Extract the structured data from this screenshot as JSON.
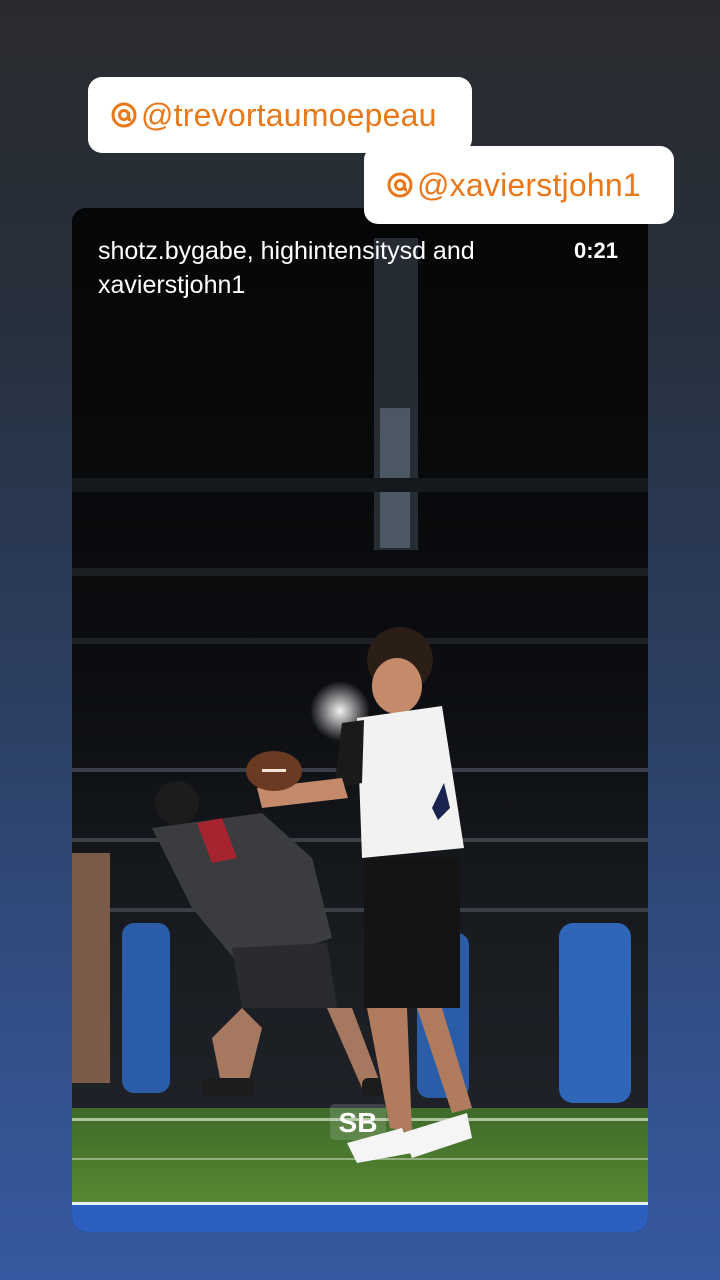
{
  "mentions": [
    {
      "handle": "@trevortaumoepeau",
      "icon": "threads-icon"
    },
    {
      "handle": "@xavierstjohn1",
      "icon": "threads-icon"
    }
  ],
  "post": {
    "authors": "shotz.bygabe, highintensitysd and xavierstjohn1",
    "duration": "0:21",
    "watermark": "SB"
  },
  "colors": {
    "mention_text": "#e9781a",
    "background_top": "#2a2b2e",
    "background_bottom": "#3558a0"
  }
}
